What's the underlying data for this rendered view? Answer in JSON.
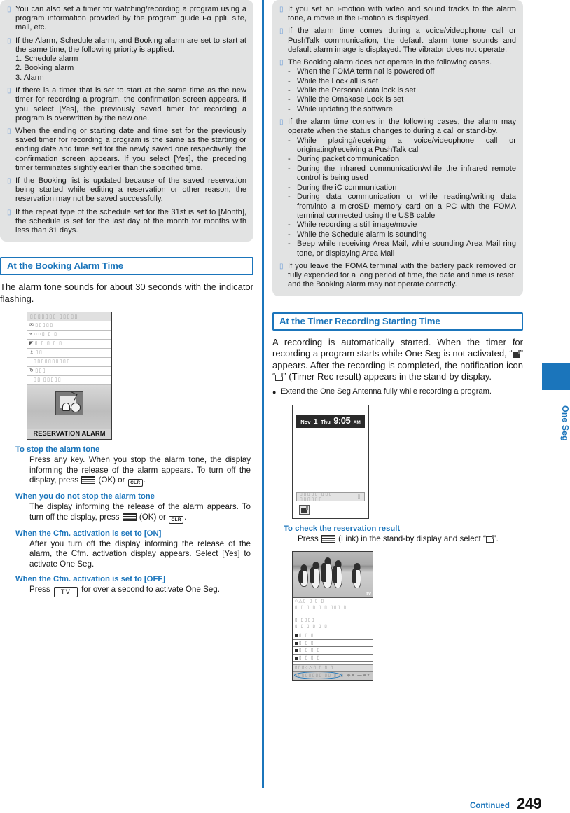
{
  "page": {
    "number": "249",
    "continued_label": "Continued",
    "side_tab_label": "One Seg",
    "accent_blue": "#1b75bb",
    "note_box_grey": "#e2e3e3"
  },
  "left_column": {
    "notes": [
      {
        "text": "You can also set a timer for watching/recording a program using a program information provided by the program guide i-α ppli, site, mail, etc."
      },
      {
        "text": "If the Alarm, Schedule alarm, and Booking alarm are set to start at the same time, the following priority is applied.",
        "numbered": [
          "1. Schedule alarm",
          "2. Booking alarm",
          "3. Alarm"
        ]
      },
      {
        "text": "If there is a timer that is set to start at the same time as the new timer for recording a program, the confirmation screen appears. If you select [Yes], the previously saved timer for recording a program is overwritten by the new one."
      },
      {
        "text": "When the ending or starting date and time set for the previously saved timer for recording a program is the same as the starting or ending date and time set for the newly saved one respectively, the confirmation screen appears. If you select [Yes], the preceding timer terminates slightly earlier than the specified time."
      },
      {
        "text": "If the Booking list is updated because of the saved reservation being started while editing a reservation or other reason, the reservation may not be saved successfully."
      },
      {
        "text": "If the repeat type of the schedule set for the 31st is set to [Month], the schedule is set for the last day of the month for months with less than 31 days."
      }
    ],
    "section": {
      "heading": "At the Booking Alarm Time",
      "intro": "The alarm tone sounds for about 30 seconds with the indicator flashing."
    },
    "alarm_screenshot": {
      "title_bar": "▯▯▯▯▯▯▯ ▯▯▯▯▯",
      "rows": [
        "▯▯▯▯▯",
        "○○▯ ▯ ▯",
        "▯ ▯ ▯ ▯ ▯",
        "▯▯",
        "▯▯▯▯▯▯▯▯▯▯",
        "▯▯▯",
        "▯▯  ▯▯▯▯▯"
      ],
      "caption": "RESERVATION ALARM"
    },
    "subsections": [
      {
        "heading": "To stop the alarm tone",
        "body_parts": [
          {
            "t": "text",
            "v": "Press any key. When you stop the alarm tone, the display informing the release of the alarm appears. To turn off the display, press "
          },
          {
            "t": "icon",
            "v": "ok-key-icon"
          },
          {
            "t": "text",
            "v": " (OK) or "
          },
          {
            "t": "icon",
            "v": "clr-key-icon",
            "label": "CLR"
          },
          {
            "t": "text",
            "v": "."
          }
        ]
      },
      {
        "heading": "When you do not stop the alarm tone",
        "body_parts": [
          {
            "t": "text",
            "v": "The display informing the release of the alarm appears. To turn off the display, press "
          },
          {
            "t": "icon",
            "v": "ok-key-icon"
          },
          {
            "t": "text",
            "v": " (OK) or "
          },
          {
            "t": "icon",
            "v": "clr-key-icon",
            "label": "CLR"
          },
          {
            "t": "text",
            "v": "."
          }
        ]
      },
      {
        "heading": "When the Cfm. activation is set to [ON]",
        "body_parts": [
          {
            "t": "text",
            "v": "After you turn off the display informing the release of the alarm, the Cfm. activation display appears. Select [Yes] to activate One Seg."
          }
        ]
      },
      {
        "heading": "When the Cfm. activation is set to [OFF]",
        "body_parts": [
          {
            "t": "text",
            "v": "Press "
          },
          {
            "t": "icon",
            "v": "tv-key-icon",
            "label": "TV"
          },
          {
            "t": "text",
            "v": " for over a second to activate One Seg."
          }
        ]
      }
    ]
  },
  "right_column": {
    "notes": [
      {
        "text": "If you set an i-motion with video and sound tracks to the alarm tone, a movie in the i-motion is displayed."
      },
      {
        "text": "If the alarm time comes during a voice/videophone call or PushTalk communication, the default alarm tone sounds and default alarm image is displayed. The vibrator does not operate."
      },
      {
        "text": "The Booking alarm does not operate in the following cases.",
        "dashes": [
          "When the FOMA terminal is powered off",
          "While the Lock all is set",
          "While the Personal data lock is set",
          "While the Omakase Lock is set",
          "While updating the software"
        ]
      },
      {
        "text": "If the alarm time comes in the following cases, the alarm may operate when the status changes to during a call or stand-by.",
        "dashes": [
          "While placing/receiving a voice/videophone call or originating/receiving a PushTalk call",
          "During packet communication",
          "During the infrared communication/while the infrared remote control is being used",
          "During the iC communication",
          "During data communication or while reading/writing data from/into a microSD memory card on a PC with the FOMA terminal connected using the USB cable",
          "While recording a still image/movie",
          "While the Schedule alarm is sounding",
          "Beep while receiving Area Mail, while sounding Area Mail ring tone, or displaying Area Mail"
        ]
      },
      {
        "text": "If you leave the FOMA terminal with the battery pack removed or fully expended for a long period of time, the date and time is reset, and the Booking alarm may not operate correctly."
      }
    ],
    "section": {
      "heading": "At the Timer Recording Starting Time",
      "intro_parts": [
        {
          "t": "text",
          "v": "A recording is automatically started. When the timer for recording a program starts while One Seg is not activated, “"
        },
        {
          "t": "icon",
          "v": "recording-icon"
        },
        {
          "t": "text",
          "v": "” appears. After the recording is completed, the notification icon “"
        },
        {
          "t": "icon",
          "v": "timer-rec-result-icon"
        },
        {
          "t": "text",
          "v": "” (Timer Rec result) appears in the stand-by display."
        }
      ],
      "bullet": "Extend the One Seg Antenna fully while recording a program."
    },
    "standby_screenshot": {
      "month": "Nov",
      "day": "1",
      "weekday": "Thu",
      "time": "9:05",
      "ampm": "AM",
      "softkey_left": "▯▯▯▯▯  ▯▯▯  ▯▯▯▯▯▯",
      "softkey_right": "▯",
      "notification_icon": "timer-rec-result-icon"
    },
    "check_result": {
      "heading": "To check the reservation result",
      "body_parts": [
        {
          "t": "text",
          "v": "Press "
        },
        {
          "t": "icon",
          "v": "ok-key-icon"
        },
        {
          "t": "text",
          "v": " (Link) in the stand-by display and select “"
        },
        {
          "t": "icon",
          "v": "timer-rec-result-icon"
        },
        {
          "t": "text",
          "v": "”."
        }
      ]
    },
    "result_screenshot": {
      "photo_alt": "penguins-photo",
      "tv_tag": "TV",
      "lines": [
        "○△▯ ▯ ▯ ▯",
        "▯ ▯ ▯ ▯ ▯ ▯ ▯▯▯ ▯",
        "",
        "▯ ▯▯▯▯",
        "▯ ▯ ▯ ▯ ▯ ▯"
      ],
      "items": [
        "▯ ▯ ▯",
        "▯ ▯ ▯",
        "▯ ▯ ▯ ▯",
        "▯ ▯ ▯ ▯"
      ],
      "foot_left": "▯▯▯○△▯ ▯ ▯ ▯",
      "selbar_left": "▯▯▯▯▯▯▯▯ ▯▯ ▯▯▯",
      "selbar_right": "◆■ ▬▰▾"
    }
  }
}
